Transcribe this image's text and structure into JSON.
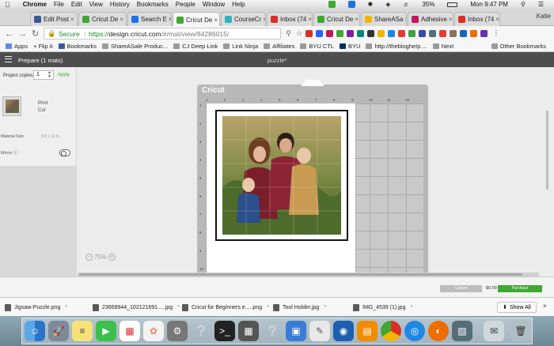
{
  "menubar": {
    "apple": "",
    "app": "Chrome",
    "items": [
      "File",
      "Edit",
      "View",
      "History",
      "Bookmarks",
      "People",
      "Window",
      "Help"
    ],
    "battery": "35%",
    "clock": "Mon 9:47 PM"
  },
  "tabs": [
    {
      "label": "Edit Post",
      "color": "#3b5998"
    },
    {
      "label": "Cricut De",
      "color": "#3fa830"
    },
    {
      "label": "Search E",
      "color": "#1a73e8"
    },
    {
      "label": "Cricut De",
      "color": "#3fa830",
      "active": true
    },
    {
      "label": "CourseCr",
      "color": "#2bb3c0"
    },
    {
      "label": "Inbox (74",
      "color": "#d93025"
    },
    {
      "label": "Cricut De",
      "color": "#3fa830"
    },
    {
      "label": "ShareASa",
      "color": "#f4b400"
    },
    {
      "label": "Adhesive",
      "color": "#c2185b"
    },
    {
      "label": "Inbox (74",
      "color": "#d93025"
    }
  ],
  "profile": "Katie",
  "address": {
    "secure": "Secure",
    "scheme": "https://",
    "host": "design.cricut.com",
    "path": "/#/mat/view/84286015/"
  },
  "bookmarks": [
    "Apps",
    "+ Flip it",
    "Bookmarks",
    "ShareASale Produc...",
    "CJ Deep Link",
    "Link Ninja",
    "Affiliates",
    "BYU CTL",
    "BYU",
    "http://theblogheIp....",
    "Next"
  ],
  "other_bookmarks": "Other Bookmarks",
  "app": {
    "prepare": "Prepare (1 mats)",
    "project_name": "puzzle*"
  },
  "left": {
    "copies_label": "Project copies:",
    "copies_value": "1",
    "apply": "Apply",
    "print": "Print",
    "cut": "Cut",
    "material_size_label": "Material Size",
    "material_size_value": "8.5 x 11 in.",
    "mirror_label": "Mirror ⓘ"
  },
  "mat": {
    "logo": "Cricut",
    "ruler": [
      "1",
      "2",
      "3",
      "4",
      "5",
      "6",
      "7",
      "8",
      "9",
      "10",
      "11",
      "12"
    ]
  },
  "zoom": "75%",
  "footer": {
    "cancel": "Cancel",
    "price": "$0.99",
    "purchase": "Purchase"
  },
  "downloads": [
    {
      "name": "Jigsaw-Puzzle.png"
    },
    {
      "name": "23668944_102121691.....jpg"
    },
    {
      "name": "Cricut for Beginners e.....png"
    },
    {
      "name": "Tool Holder.jpg"
    },
    {
      "name": "IMG_4539 (1).jpg"
    }
  ],
  "show_all": "Show All",
  "dock": [
    "Finder",
    "Launchpad",
    "Notes",
    "FaceTime",
    "Calendar",
    "Photos",
    "System Preferences",
    "Help",
    "Terminal",
    "Calculator",
    "Help",
    "Preview",
    "Sketch",
    "Dashboard",
    "Books",
    "Chrome",
    "Safari",
    "Firefox",
    "Photos",
    "Mail",
    "Trash"
  ]
}
